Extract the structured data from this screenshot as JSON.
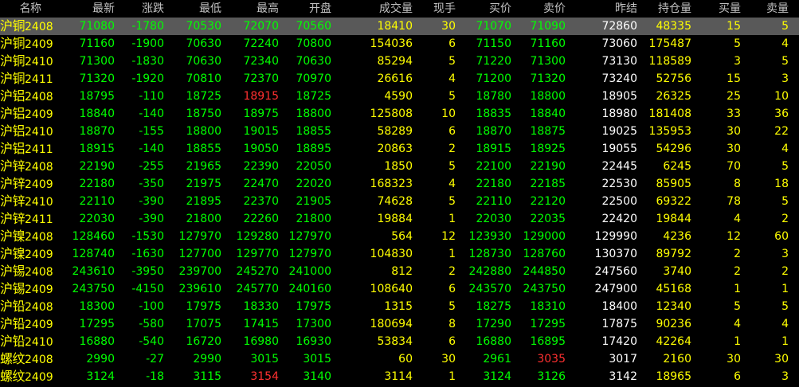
{
  "headers": {
    "name": "名称",
    "last": "最新",
    "change": "涨跌",
    "low": "最低",
    "high": "最高",
    "open": "开盘",
    "volume": "成交量",
    "current": "现手",
    "bid": "买价",
    "ask": "卖价",
    "prev_settle": "昨结",
    "open_interest": "持仓量",
    "bid_qty": "买量",
    "ask_qty": "卖量"
  },
  "colors": {
    "up": "#ff3030",
    "down": "#00ff00",
    "neutral": "#ffffff",
    "volume": "#ffff00",
    "selected_row": "#595959"
  },
  "selected_index": 0,
  "rows": [
    {
      "prefix": "沪铜",
      "code": "2408",
      "last": "71080",
      "change": "-1780",
      "low": "70530",
      "high": "72070",
      "open": "70560",
      "volume": "18410",
      "current": "30",
      "bid": "71070",
      "ask": "71090",
      "prev_settle": "72860",
      "open_interest": "48335",
      "bid_qty": "15",
      "ask_qty": "5"
    },
    {
      "prefix": "沪铜",
      "code": "2409",
      "last": "71160",
      "change": "-1900",
      "low": "70630",
      "high": "72240",
      "open": "70800",
      "volume": "154036",
      "current": "6",
      "bid": "71150",
      "ask": "71160",
      "prev_settle": "73060",
      "open_interest": "175487",
      "bid_qty": "5",
      "ask_qty": "4"
    },
    {
      "prefix": "沪铜",
      "code": "2410",
      "last": "71300",
      "change": "-1830",
      "low": "70630",
      "high": "72340",
      "open": "70630",
      "volume": "85294",
      "current": "5",
      "bid": "71220",
      "ask": "71300",
      "prev_settle": "73130",
      "open_interest": "118589",
      "bid_qty": "3",
      "ask_qty": "5"
    },
    {
      "prefix": "沪铜",
      "code": "2411",
      "last": "71320",
      "change": "-1920",
      "low": "70810",
      "high": "72370",
      "open": "70970",
      "volume": "26616",
      "current": "4",
      "bid": "71200",
      "ask": "71320",
      "prev_settle": "73240",
      "open_interest": "52756",
      "bid_qty": "15",
      "ask_qty": "3"
    },
    {
      "prefix": "沪铝",
      "code": "2408",
      "last": "18795",
      "change": "-110",
      "low": "18725",
      "high": "18915",
      "open": "18725",
      "volume": "4590",
      "current": "5",
      "bid": "18780",
      "ask": "18800",
      "prev_settle": "18905",
      "open_interest": "26325",
      "bid_qty": "25",
      "ask_qty": "10",
      "high_up": true
    },
    {
      "prefix": "沪铝",
      "code": "2409",
      "last": "18840",
      "change": "-140",
      "low": "18750",
      "high": "18975",
      "open": "18800",
      "volume": "125808",
      "current": "10",
      "bid": "18835",
      "ask": "18840",
      "prev_settle": "18980",
      "open_interest": "181408",
      "bid_qty": "33",
      "ask_qty": "36"
    },
    {
      "prefix": "沪铝",
      "code": "2410",
      "last": "18870",
      "change": "-155",
      "low": "18800",
      "high": "19015",
      "open": "18855",
      "volume": "58289",
      "current": "6",
      "bid": "18870",
      "ask": "18875",
      "prev_settle": "19025",
      "open_interest": "135953",
      "bid_qty": "30",
      "ask_qty": "22"
    },
    {
      "prefix": "沪铝",
      "code": "2411",
      "last": "18915",
      "change": "-140",
      "low": "18855",
      "high": "19050",
      "open": "18895",
      "volume": "20863",
      "current": "2",
      "bid": "18915",
      "ask": "18925",
      "prev_settle": "19055",
      "open_interest": "54296",
      "bid_qty": "30",
      "ask_qty": "4"
    },
    {
      "prefix": "沪锌",
      "code": "2408",
      "last": "22190",
      "change": "-255",
      "low": "21965",
      "high": "22390",
      "open": "22050",
      "volume": "1850",
      "current": "5",
      "bid": "22100",
      "ask": "22190",
      "prev_settle": "22445",
      "open_interest": "6245",
      "bid_qty": "70",
      "ask_qty": "5"
    },
    {
      "prefix": "沪锌",
      "code": "2409",
      "last": "22180",
      "change": "-350",
      "low": "21975",
      "high": "22470",
      "open": "22020",
      "volume": "168323",
      "current": "4",
      "bid": "22180",
      "ask": "22185",
      "prev_settle": "22530",
      "open_interest": "85905",
      "bid_qty": "8",
      "ask_qty": "18"
    },
    {
      "prefix": "沪锌",
      "code": "2410",
      "last": "22110",
      "change": "-390",
      "low": "21895",
      "high": "22370",
      "open": "21905",
      "volume": "74628",
      "current": "5",
      "bid": "22110",
      "ask": "22120",
      "prev_settle": "22500",
      "open_interest": "69322",
      "bid_qty": "78",
      "ask_qty": "5"
    },
    {
      "prefix": "沪锌",
      "code": "2411",
      "last": "22030",
      "change": "-390",
      "low": "21800",
      "high": "22260",
      "open": "21800",
      "volume": "19884",
      "current": "1",
      "bid": "22030",
      "ask": "22035",
      "prev_settle": "22420",
      "open_interest": "19844",
      "bid_qty": "4",
      "ask_qty": "2"
    },
    {
      "prefix": "沪镍",
      "code": "2408",
      "last": "128460",
      "change": "-1530",
      "low": "127970",
      "high": "129280",
      "open": "127970",
      "volume": "564",
      "current": "12",
      "bid": "123930",
      "ask": "129000",
      "prev_settle": "129990",
      "open_interest": "4236",
      "bid_qty": "12",
      "ask_qty": "60"
    },
    {
      "prefix": "沪镍",
      "code": "2409",
      "last": "128740",
      "change": "-1630",
      "low": "127700",
      "high": "129770",
      "open": "127970",
      "volume": "104830",
      "current": "1",
      "bid": "128730",
      "ask": "128760",
      "prev_settle": "130370",
      "open_interest": "89792",
      "bid_qty": "2",
      "ask_qty": "3"
    },
    {
      "prefix": "沪锡",
      "code": "2408",
      "last": "243610",
      "change": "-3950",
      "low": "239700",
      "high": "245270",
      "open": "241000",
      "volume": "812",
      "current": "2",
      "bid": "242880",
      "ask": "244850",
      "prev_settle": "247560",
      "open_interest": "3740",
      "bid_qty": "2",
      "ask_qty": "2"
    },
    {
      "prefix": "沪锡",
      "code": "2409",
      "last": "243750",
      "change": "-4150",
      "low": "239610",
      "high": "245770",
      "open": "240160",
      "volume": "108640",
      "current": "6",
      "bid": "243570",
      "ask": "243750",
      "prev_settle": "247900",
      "open_interest": "45168",
      "bid_qty": "1",
      "ask_qty": "1"
    },
    {
      "prefix": "沪铅",
      "code": "2408",
      "last": "18300",
      "change": "-100",
      "low": "17975",
      "high": "18330",
      "open": "17975",
      "volume": "1315",
      "current": "5",
      "bid": "18275",
      "ask": "18310",
      "prev_settle": "18400",
      "open_interest": "12340",
      "bid_qty": "5",
      "ask_qty": "5"
    },
    {
      "prefix": "沪铅",
      "code": "2409",
      "last": "17295",
      "change": "-580",
      "low": "17075",
      "high": "17415",
      "open": "17300",
      "volume": "180694",
      "current": "8",
      "bid": "17290",
      "ask": "17295",
      "prev_settle": "17875",
      "open_interest": "90236",
      "bid_qty": "4",
      "ask_qty": "4"
    },
    {
      "prefix": "沪铅",
      "code": "2410",
      "last": "16880",
      "change": "-540",
      "low": "16720",
      "high": "16980",
      "open": "16930",
      "volume": "53834",
      "current": "6",
      "bid": "16880",
      "ask": "16895",
      "prev_settle": "17420",
      "open_interest": "42264",
      "bid_qty": "1",
      "ask_qty": "1"
    },
    {
      "prefix": "螺纹",
      "code": "2408",
      "last": "2990",
      "change": "-27",
      "low": "2990",
      "high": "3015",
      "open": "3015",
      "volume": "60",
      "current": "30",
      "bid": "2961",
      "ask": "3035",
      "prev_settle": "3017",
      "open_interest": "2160",
      "bid_qty": "30",
      "ask_qty": "30",
      "ask_up": true
    },
    {
      "prefix": "螺纹",
      "code": "2409",
      "last": "3124",
      "change": "-18",
      "low": "3115",
      "high": "3154",
      "open": "3140",
      "volume": "3114",
      "current": "1",
      "bid": "3124",
      "ask": "3126",
      "prev_settle": "3142",
      "open_interest": "18965",
      "bid_qty": "6",
      "ask_qty": "3",
      "high_up": true
    }
  ]
}
